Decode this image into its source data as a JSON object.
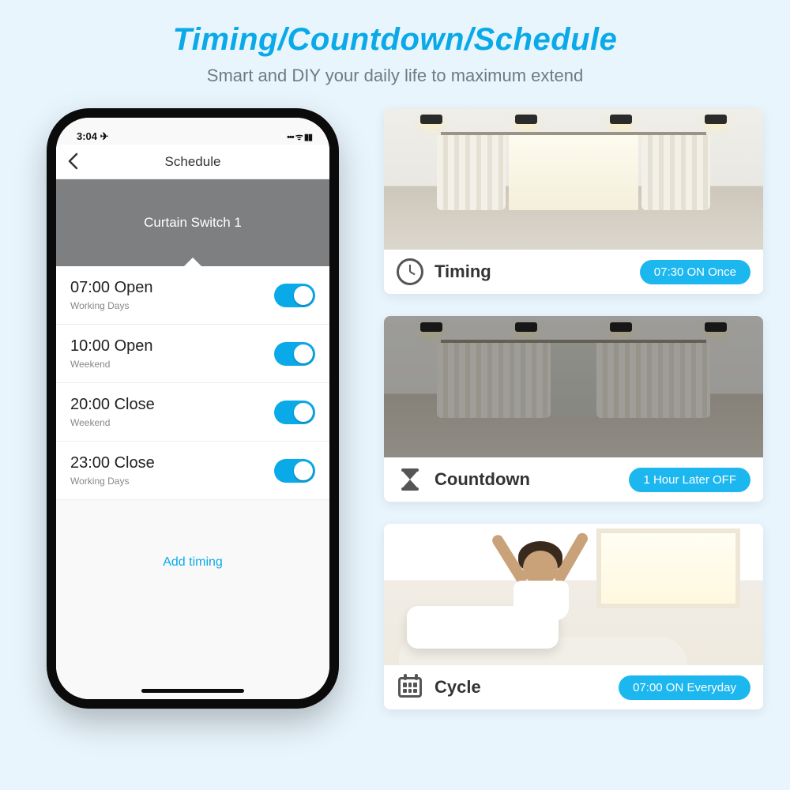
{
  "header": {
    "title": "Timing/Countdown/Schedule",
    "subtitle": "Smart and DIY your daily life to maximum extend"
  },
  "phone": {
    "status_time": "3:04 ✈",
    "status_right": "••• ᯤ ▮▮",
    "screen_title": "Schedule",
    "device_name": "Curtain Switch 1",
    "add_label": "Add timing",
    "schedules": [
      {
        "time": "07:00 Open",
        "days": "Working Days"
      },
      {
        "time": "10:00 Open",
        "days": "Weekend"
      },
      {
        "time": "20:00 Close",
        "days": "Weekend"
      },
      {
        "time": "23:00 Close",
        "days": "Working Days"
      }
    ]
  },
  "cards": [
    {
      "label": "Timing",
      "pill": "07:30 ON Once"
    },
    {
      "label": "Countdown",
      "pill": "1 Hour Later OFF"
    },
    {
      "label": "Cycle",
      "pill": "07:00 ON Everyday"
    }
  ]
}
